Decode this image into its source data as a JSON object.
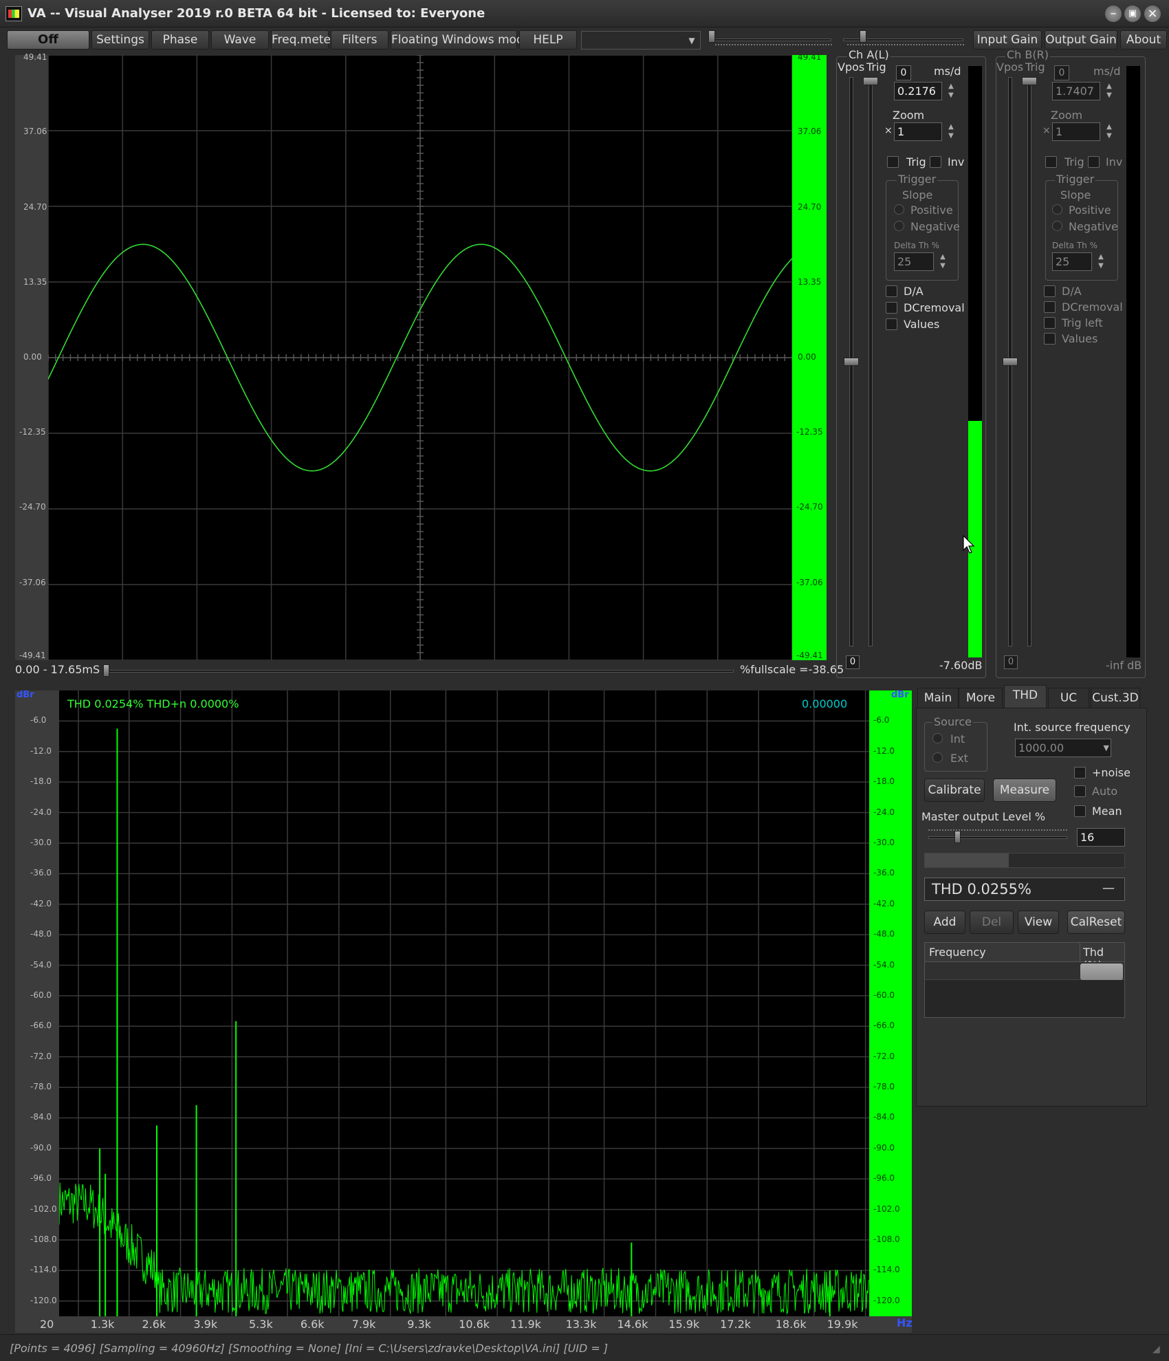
{
  "window": {
    "title": "VA -- Visual Analyser 2019 r.0 BETA 64 bit - Licensed to: Everyone",
    "minimize_icon": "minimize-icon",
    "maximize_icon": "maximize-icon",
    "close_icon": "close-icon"
  },
  "toolbar": {
    "off": "Off",
    "settings": "Settings",
    "phase": "Phase",
    "wave": "Wave",
    "freq_meter": "Freq.meter",
    "filters": "Filters",
    "floating": "Floating Windows mode",
    "help": "HELP",
    "combo_value": "",
    "input_gain": "Input Gain",
    "output_gain": "Output Gain",
    "about": "About"
  },
  "scope": {
    "y_ticks": [
      "49.41",
      "37.06",
      "24.70",
      "13.35",
      "0.00",
      "-12.35",
      "-24.70",
      "-37.06",
      "-49.41"
    ],
    "time_range": "0.00 - 17.65mS",
    "fullscale": "%fullscale =-38.65",
    "trace_color": "#33dd33",
    "wave_amplitude_units": 18.5,
    "wave_cycles_visible": 2.2
  },
  "ch_a": {
    "title": "Ch A(L)",
    "vpos": "Vpos",
    "trig": "Trig",
    "zero": "0",
    "ms_label": "ms/d",
    "ms_value": "0.2176",
    "zoom_label": "Zoom",
    "zoom_x": "×",
    "zoom_value": "1",
    "trig_chk": "Trig",
    "inv_chk": "Inv",
    "trigger_group": "Trigger",
    "slope": "Slope",
    "positive": "Positive",
    "negative": "Negative",
    "delta_th": "Delta Th %",
    "delta_value": "25",
    "da": "D/A",
    "dcremoval": "DCremoval",
    "values": "Values",
    "bottom_zero": "0",
    "level": "-7.60dB",
    "meter_fill": 0.4
  },
  "ch_b": {
    "title": "Ch B(R)",
    "vpos": "Vpos",
    "trig": "Trig",
    "zero": "0",
    "ms_label": "ms/d",
    "ms_value": "1.7407",
    "zoom_label": "Zoom",
    "zoom_x": "×",
    "zoom_value": "1",
    "trig_chk": "Trig",
    "inv_chk": "Inv",
    "trigger_group": "Trigger",
    "slope": "Slope",
    "positive": "Positive",
    "negative": "Negative",
    "delta_th": "Delta Th %",
    "delta_value": "25",
    "da": "D/A",
    "dcremoval": "DCremoval",
    "trig_left": "Trig left",
    "values": "Values",
    "bottom_zero": "0",
    "level": "-inf dB",
    "meter_fill": 0
  },
  "spectrum": {
    "unit": "dBr",
    "thd_text": "THD 0.0254% THD+n 0.0000%",
    "readout": "0.00000",
    "y_ticks": [
      "-6.0",
      "-12.0",
      "-18.0",
      "-24.0",
      "-30.0",
      "-36.0",
      "-42.0",
      "-48.0",
      "-54.0",
      "-60.0",
      "-66.0",
      "-72.0",
      "-78.0",
      "-84.0",
      "-90.0",
      "-96.0",
      "-102.0",
      "-108.0",
      "-114.0",
      "-120.0"
    ],
    "x_ticks": [
      "20",
      "1.3k",
      "2.6k",
      "3.9k",
      "5.3k",
      "6.6k",
      "7.9k",
      "9.3k",
      "10.6k",
      "11.9k",
      "13.3k",
      "14.6k",
      "15.9k",
      "17.2k",
      "18.6k",
      "19.9k"
    ],
    "x_unit": "Hz",
    "trace_color": "#00ff00"
  },
  "chart_data": {
    "type": "line",
    "title": "",
    "xlabel": "Hz",
    "ylabel": "dBr",
    "xlim": [
      20,
      20480
    ],
    "ylim": [
      -123,
      0
    ],
    "peaks": {
      "x": [
        1000,
        2000,
        3000,
        4000,
        13990,
        19000
      ],
      "y": [
        -7.5,
        -85.5,
        -81.5,
        -65.0,
        -108.5,
        -114.0
      ],
      "note": "visible spectral peaks"
    },
    "noise_floor": -120.5
  },
  "tabs": {
    "main": "Main",
    "more": "More",
    "thd": "THD",
    "uc": "UC",
    "cust3d": "Cust.3D"
  },
  "thd_panel": {
    "source": "Source",
    "int": "Int",
    "ext": "Ext",
    "int_freq_label": "Int. source frequency",
    "int_freq_value": "1000.00",
    "noise": "+noise",
    "auto": "Auto",
    "mean": "Mean",
    "calibrate": "Calibrate",
    "measure": "Measure",
    "master_level": "Master output Level %",
    "master_value": "16",
    "master_slider": 0.16,
    "progress": 0.42,
    "thd_result": "THD 0.0255%",
    "thd_dash": "—",
    "add": "Add",
    "del": "Del",
    "view": "View",
    "calreset": "CalReset",
    "col_frequency": "Frequency",
    "col_thd": "Thd (%)"
  },
  "status": {
    "text": "[Points = 4096]  [Sampling = 40960Hz]  [Smoothing = None]  [Ini = C:\\Users\\zdravke\\Desktop\\VA.ini]  [UID = ]"
  }
}
